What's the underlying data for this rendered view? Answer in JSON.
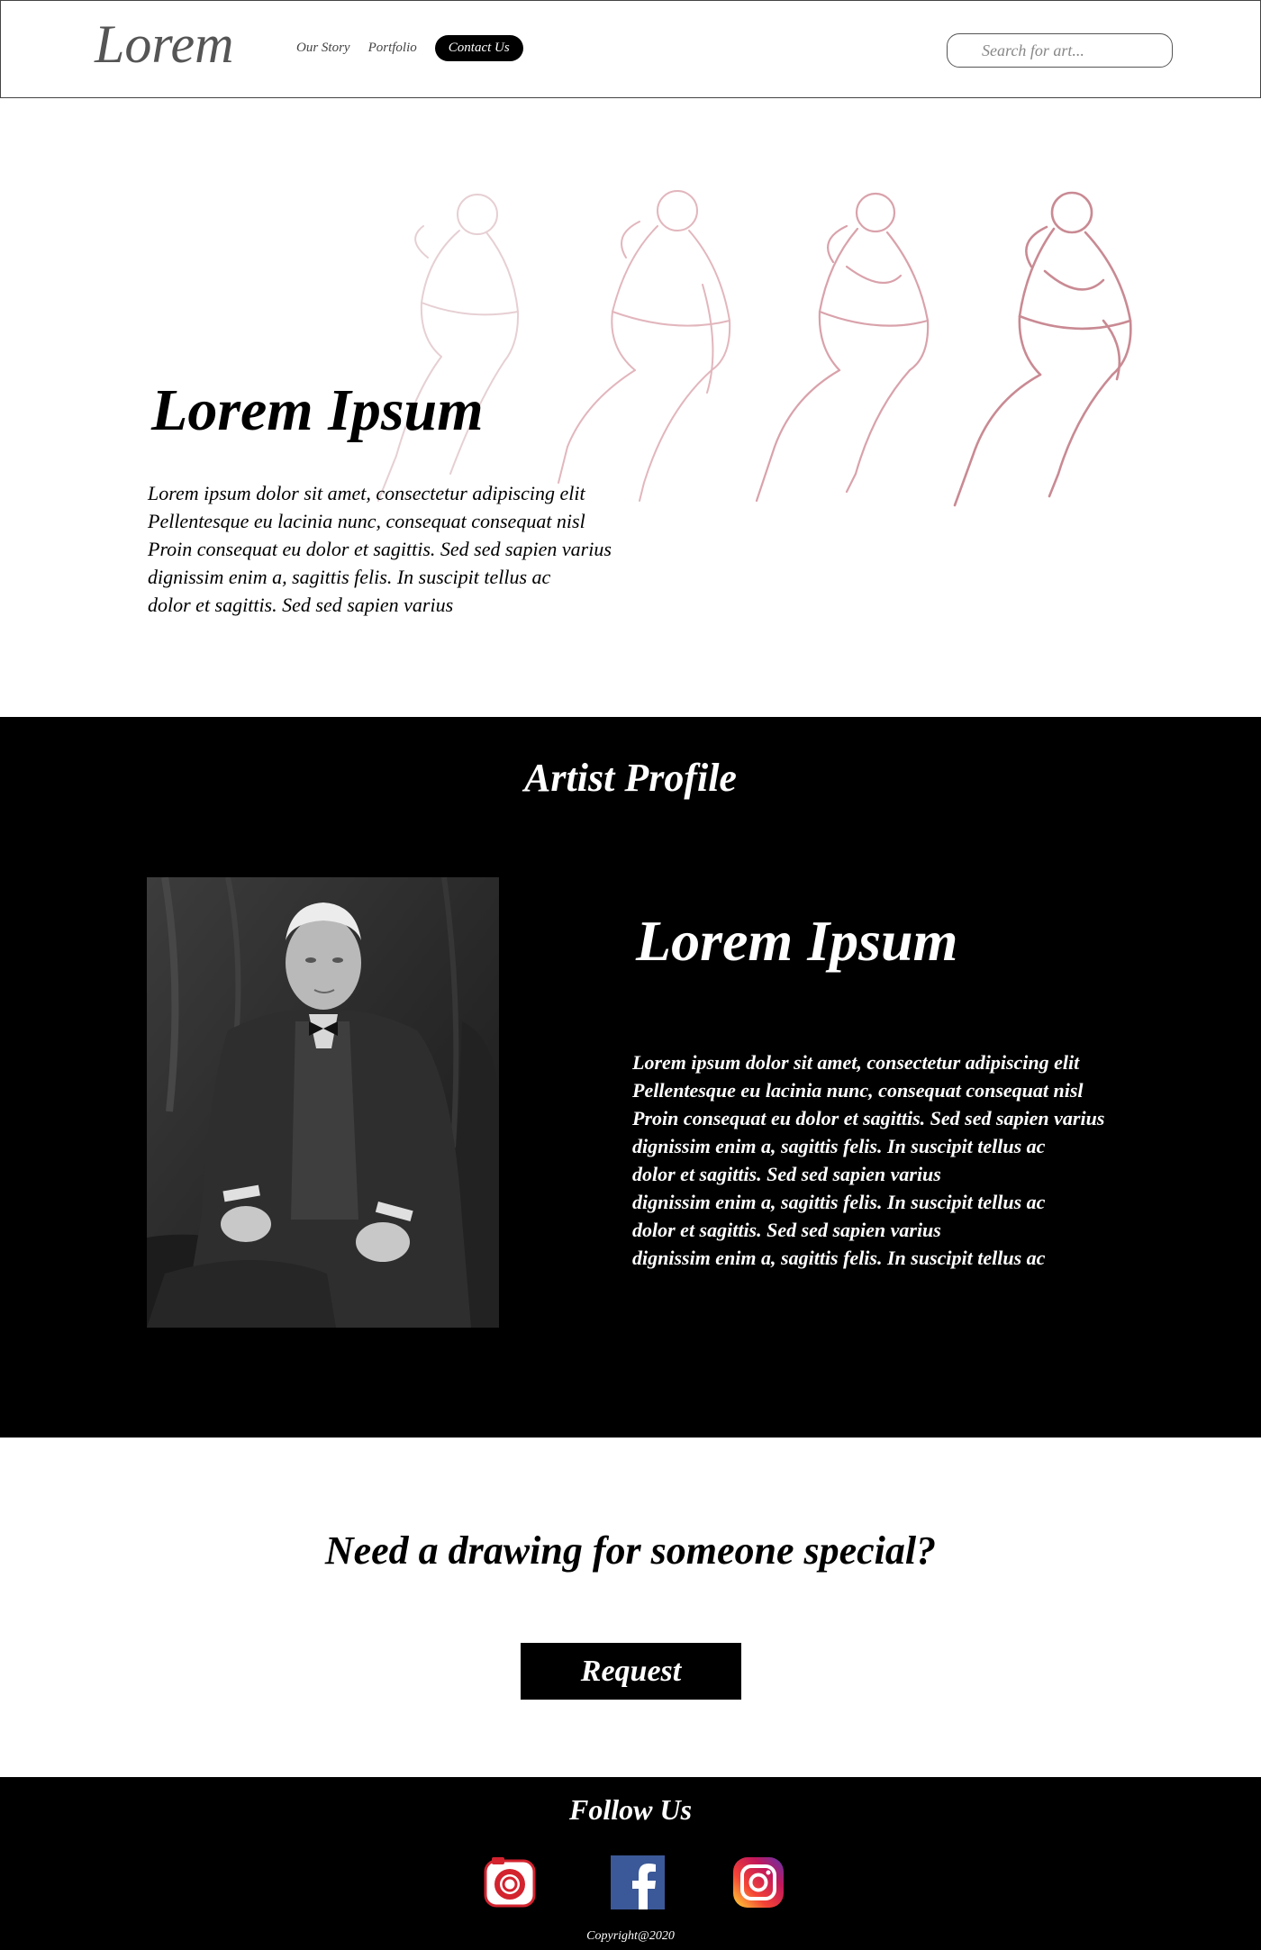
{
  "header": {
    "logo": "Lorem",
    "nav": [
      "Our Story",
      "Portfolio",
      "Contact Us"
    ],
    "active_nav": "Contact Us",
    "search_placeholder": "Search for art..."
  },
  "hero": {
    "title": "Lorem Ipsum",
    "lines": [
      "Lorem ipsum dolor sit amet, consectetur adipiscing elit",
      "Pellentesque eu lacinia nunc, consequat consequat nisl",
      "Proin consequat eu dolor et sagittis. Sed sed sapien varius",
      "dignissim enim a, sagittis felis. In suscipit tellus ac",
      "dolor et sagittis. Sed sed sapien varius"
    ]
  },
  "profile": {
    "heading": "Artist Profile",
    "name": "Lorem Ipsum",
    "lines": [
      "Lorem ipsum dolor sit amet, consectetur adipiscing elit",
      "Pellentesque eu lacinia nunc, consequat consequat nisl",
      "Proin consequat eu dolor et sagittis. Sed sed sapien varius",
      "dignissim enim a, sagittis felis. In suscipit tellus ac",
      "dolor et sagittis. Sed sed sapien varius",
      "dignissim enim a, sagittis felis. In suscipit tellus ac",
      "dolor et sagittis. Sed sed sapien varius",
      "dignissim enim a, sagittis felis. In suscipit tellus ac"
    ]
  },
  "cta": {
    "heading": "Need a drawing for someone special?",
    "button": "Request"
  },
  "footer": {
    "follow": "Follow Us",
    "socials": [
      "camera-app-icon",
      "facebook-icon",
      "instagram-icon"
    ],
    "copyright": "Copyright@2020"
  },
  "colors": {
    "background": "#ffffff",
    "dark_section": "#000000",
    "sketch": "#c98a93",
    "facebook": "#3b5998"
  }
}
